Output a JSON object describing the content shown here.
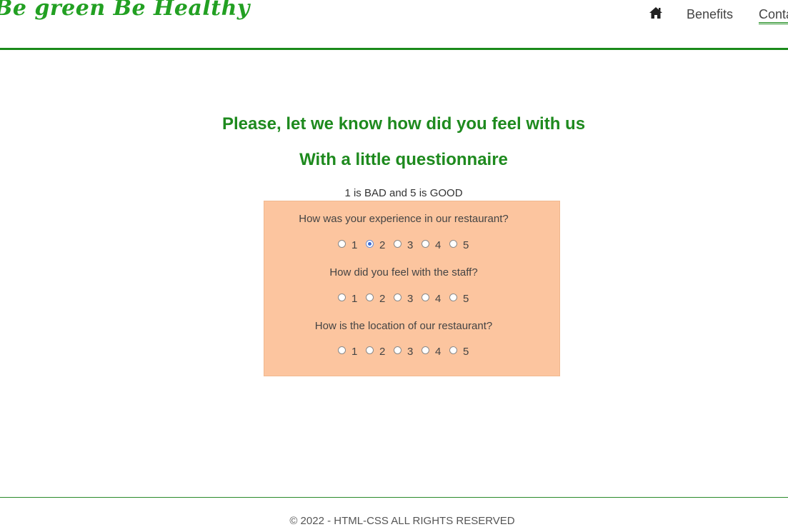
{
  "header": {
    "logo": "Be green Be Healthy",
    "nav": {
      "home_icon": "home-icon",
      "benefits": "Benefits",
      "contact": "Contact"
    }
  },
  "main": {
    "title": "Please, let we know how did you feel with us",
    "subtitle": "With a little questionnaire",
    "scale_note": "1 is BAD and 5 is GOOD",
    "questions": [
      {
        "text": "How was your experience in our restaurant?",
        "options": [
          "1",
          "2",
          "3",
          "4",
          "5"
        ],
        "selected": "2"
      },
      {
        "text": "How did you feel with the staff?",
        "options": [
          "1",
          "2",
          "3",
          "4",
          "5"
        ],
        "selected": null
      },
      {
        "text": "How is the location of our restaurant?",
        "options": [
          "1",
          "2",
          "3",
          "4",
          "5"
        ],
        "selected": null
      }
    ]
  },
  "footer": {
    "text": "© 2022 - HTML-CSS ALL RIGHTS RESERVED"
  },
  "colors": {
    "accent": "#1e8a1e",
    "form_bg": "#fcc59f"
  }
}
